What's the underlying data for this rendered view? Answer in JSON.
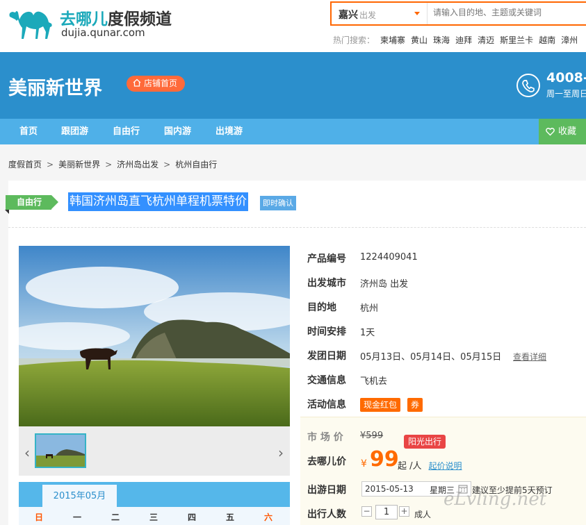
{
  "header": {
    "logo_title_a": "去哪儿",
    "logo_title_b": "度假频道",
    "logo_sub": "dujia.qunar.com",
    "city": "嘉兴",
    "city_suffix": "出发",
    "search_placeholder": "请输入目的地、主题或关键词",
    "hot_label": "热门搜索：",
    "hot_items": [
      "柬埔寨",
      "黄山",
      "珠海",
      "迪拜",
      "清迈",
      "斯里兰卡",
      "越南",
      "漳州"
    ]
  },
  "banner": {
    "shop_name": "美丽新世界",
    "shop_home": "店铺首页",
    "phone": "4008-",
    "phone_sub": "周一至周日"
  },
  "nav": {
    "items": [
      "首页",
      "跟团游",
      "自由行",
      "国内游",
      "出境游"
    ],
    "favorite": "收藏"
  },
  "breadcrumb": [
    "度假首页",
    "美丽新世界",
    "济州岛出发",
    "杭州自由行"
  ],
  "product": {
    "type_tag": "自由行",
    "title": "韩国济州岛直飞杭州单程机票特价",
    "instant_tag": "即时确认"
  },
  "details": {
    "code_label": "产品编号",
    "code": "1224409041",
    "depart_label": "出发城市",
    "depart": "济州岛 出发",
    "dest_label": "目的地",
    "dest": "杭州",
    "time_label": "时间安排",
    "time": "1天",
    "dates_label": "发团日期",
    "dates": "05月13日、05月14日、05月15日",
    "dates_link": "查看详细",
    "transport_label": "交通信息",
    "transport": "飞机去",
    "activity_label": "活动信息",
    "activity_badges": [
      "现金红包",
      "券"
    ]
  },
  "price": {
    "market_label": "市 场 价",
    "market": "¥599",
    "promo": "阳光出行",
    "qunar_label": "去哪儿价",
    "currency": "¥",
    "value": "99",
    "per": "起 /人",
    "explain": "起价说明",
    "date_label": "出游日期",
    "date": "2015-05-13",
    "weekday": "星期三",
    "advise": "建议至少提前5天预订",
    "people_label": "出行人数",
    "people": "1",
    "people_unit": "成人"
  },
  "calendar": {
    "month": "2015年05月",
    "weekdays": [
      "日",
      "一",
      "二",
      "三",
      "四",
      "五",
      "六"
    ]
  },
  "watermark": "eLvling.net",
  "colors": {
    "accent": "#ff6600",
    "banner": "#2b8fcc",
    "nav": "#4fb0e8",
    "green": "#5dba5d",
    "price": "#ff6a00"
  }
}
